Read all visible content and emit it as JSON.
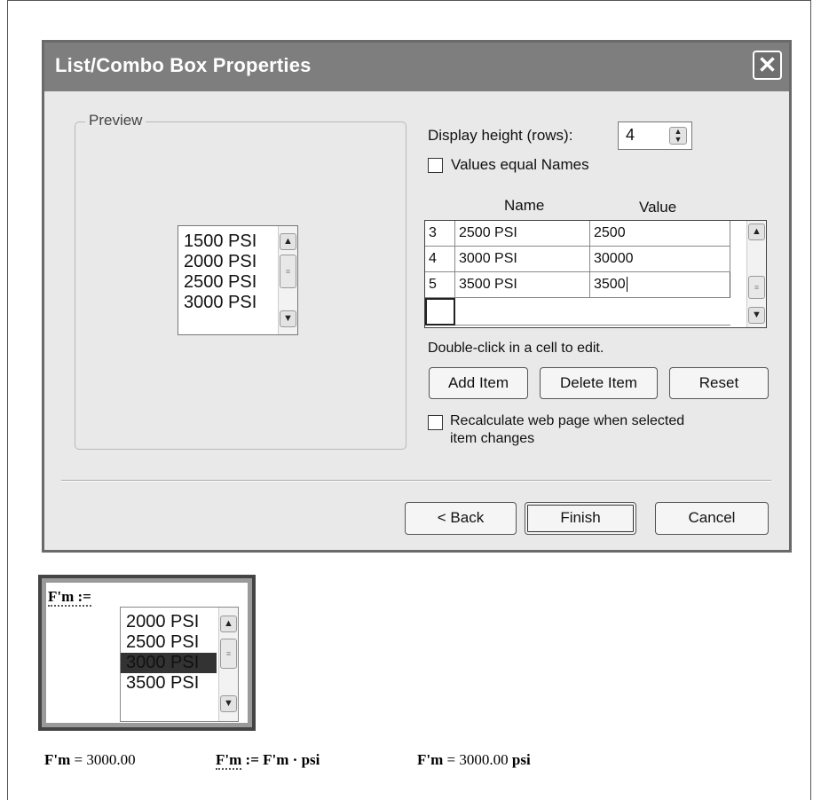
{
  "dialog": {
    "title": "List/Combo Box Properties",
    "close_icon": "close-icon",
    "preview": {
      "label": "Preview",
      "items": [
        "1500 PSI",
        "2000 PSI",
        "2500 PSI",
        "3000 PSI"
      ]
    },
    "display_height": {
      "label": "Display height (rows):",
      "value": "4"
    },
    "values_equal_names": {
      "label": "Values equal Names",
      "checked": false
    },
    "table": {
      "headers": [
        "Name",
        "Value"
      ],
      "rows": [
        {
          "num": "3",
          "name": "2500 PSI",
          "value": "2500"
        },
        {
          "num": "4",
          "name": "3000 PSI",
          "value": "30000"
        },
        {
          "num": "5",
          "name": "3500 PSI",
          "value": "3500"
        },
        {
          "num": "",
          "name": "",
          "value": ""
        }
      ]
    },
    "hint": "Double-click in a cell to edit.",
    "buttons": {
      "add": "Add Item",
      "delete": "Delete Item",
      "reset": "Reset",
      "back": "< Back",
      "finish": "Finish",
      "cancel": "Cancel"
    },
    "recalc": {
      "label_line1": "Recalculate web page when selected",
      "label_line2": "item changes",
      "checked": false
    }
  },
  "worksheet": {
    "assign_label": "F'm :=",
    "list_items": [
      "2000 PSI",
      "2500 PSI",
      "3000 PSI",
      "3500 PSI"
    ],
    "selected_item": "3000 PSI",
    "result1_lhs": "F'm",
    "result1_rhs": "= 3000.00",
    "assign2_lhs": "F'm",
    "assign2_rhs": ":= F'm · psi",
    "result2_lhs": "F'm",
    "result2_rhs_num": "= 3000.00",
    "result2_rhs_unit": "psi"
  },
  "colors": {
    "titlebar": "#7e7e7e",
    "dialog_bg": "#e9e9e9",
    "selection": "#333333"
  }
}
